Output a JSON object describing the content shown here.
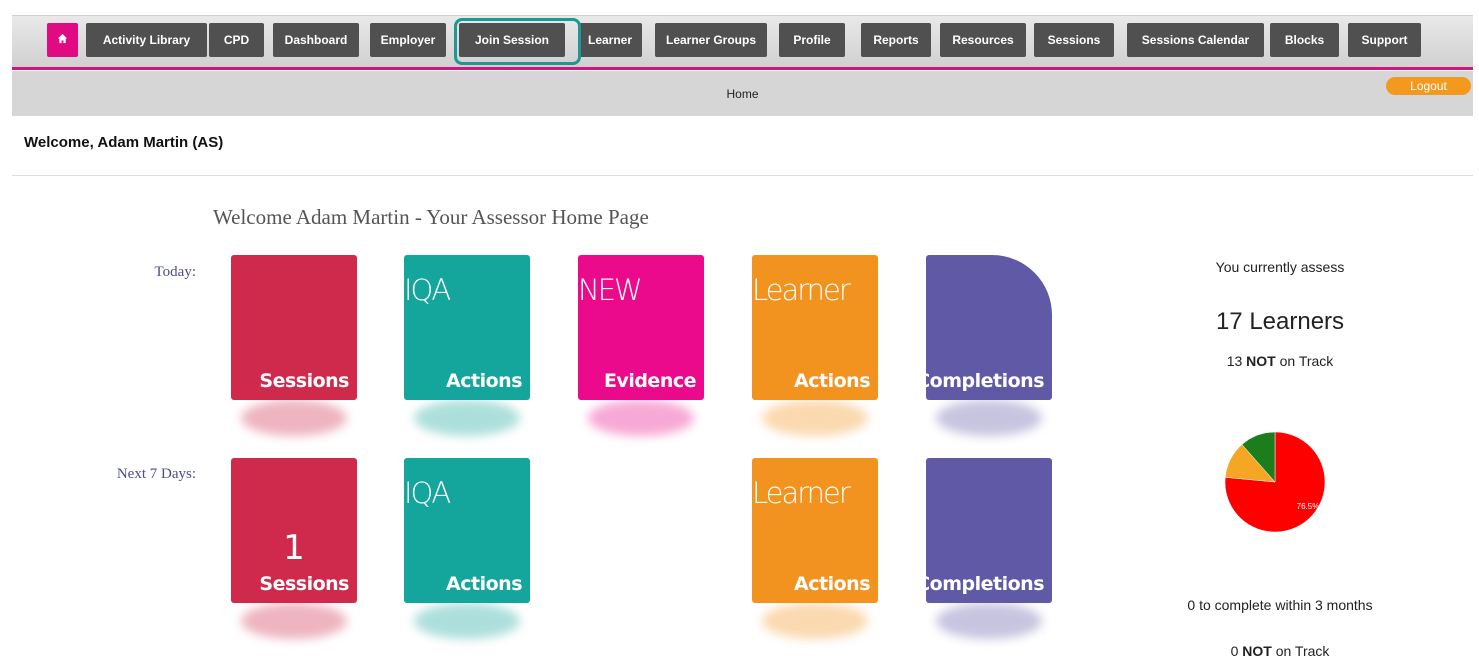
{
  "colors": {
    "brand_pink": "#e00a82",
    "tab_bg": "#505050",
    "highlight": "#1a9a93",
    "logout": "#f39a1e",
    "pie_red": "#ff0000",
    "pie_orange": "#f5a623",
    "pie_green": "#1c7d1c"
  },
  "nav": {
    "home_icon": "home-icon",
    "tabs": [
      "Activity Library",
      "CPD",
      "Dashboard",
      "Employer",
      "Join Session",
      "Learner",
      "Learner Groups",
      "Profile",
      "Reports",
      "Resources",
      "Sessions",
      "Sessions Calendar",
      "Blocks",
      "Support"
    ],
    "highlighted_tab": "Join Session"
  },
  "subbar": {
    "home": "Home",
    "logout": "Logout"
  },
  "welcome": {
    "bar": "Welcome, Adam Martin (AS)",
    "heading": "Welcome Adam Martin - Your Assessor Home Page"
  },
  "rows": {
    "today": {
      "label": "Today:",
      "tiles": [
        {
          "top": "",
          "number": "",
          "bottom": "Sessions"
        },
        {
          "top": "IQA",
          "number": "",
          "bottom": "Actions"
        },
        {
          "top": "NEW",
          "number": "",
          "bottom": "Evidence"
        },
        {
          "top": "Learner",
          "number": "",
          "bottom": "Actions"
        },
        {
          "top": "",
          "number": "",
          "bottom": "Completions"
        }
      ]
    },
    "next7": {
      "label": "Next 7 Days:",
      "tiles": [
        {
          "top": "",
          "number": "1",
          "bottom": "Sessions"
        },
        {
          "top": "IQA",
          "number": "",
          "bottom": "Actions"
        },
        {
          "top": "Learner",
          "number": "",
          "bottom": "Actions"
        },
        {
          "top": "",
          "number": "",
          "bottom": "Completions"
        }
      ]
    }
  },
  "summary": {
    "assess_intro": "You currently assess",
    "learner_count": "17 Learners",
    "not_track_num": "13",
    "not_word": "NOT",
    "on_track": "on Track",
    "pie_label": "76.5%",
    "complete_text": "0 to complete within 3 months",
    "not_track_num_2": "0"
  },
  "chart_data": {
    "type": "pie",
    "slices": [
      {
        "value": 76.5,
        "color": "#ff0000"
      },
      {
        "value": 12.0,
        "color": "#f5a623"
      },
      {
        "value": 11.5,
        "color": "#1c7d1c"
      }
    ]
  }
}
